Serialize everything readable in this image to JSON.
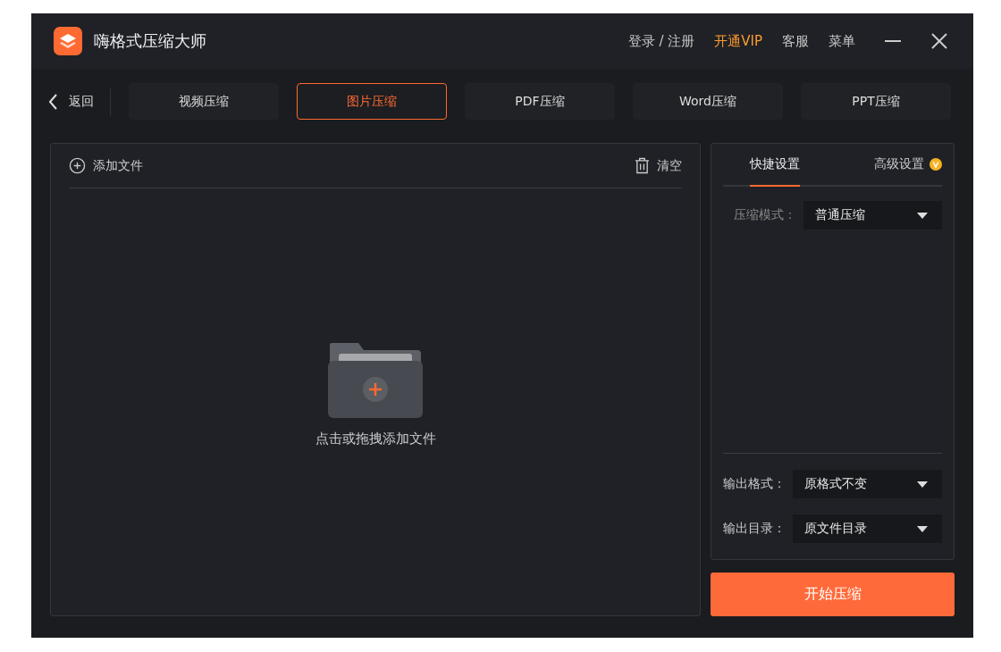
{
  "window": {
    "title": "嗨格式压缩大师"
  },
  "header_links": [
    {
      "label": "登录 / 注册",
      "kind": "plain"
    },
    {
      "label": "开通VIP",
      "kind": "vip"
    },
    {
      "label": "客服",
      "kind": "plain"
    },
    {
      "label": "菜单",
      "kind": "plain"
    }
  ],
  "back": {
    "label": "返回"
  },
  "tabs": [
    {
      "label": "视频压缩",
      "selected": false
    },
    {
      "label": "图片压缩",
      "selected": true
    },
    {
      "label": "PDF压缩",
      "selected": false
    },
    {
      "label": "Word压缩",
      "selected": false
    },
    {
      "label": "PPT压缩",
      "selected": false
    }
  ],
  "file_panel": {
    "add_label": "添加文件",
    "clear_label": "清空",
    "drop_hint": "点击或拖拽添加文件"
  },
  "settings": {
    "tabs": [
      {
        "label": "快捷设置",
        "selected": true,
        "vip": false
      },
      {
        "label": "高级设置",
        "selected": false,
        "vip": true
      }
    ],
    "mode": {
      "label": "压缩模式：",
      "value": "普通压缩"
    },
    "outputs": [
      {
        "label": "输出格式：",
        "value": "原格式不变"
      },
      {
        "label": "输出目录：",
        "value": "原文件目录"
      }
    ]
  },
  "start_button": "开始压缩"
}
